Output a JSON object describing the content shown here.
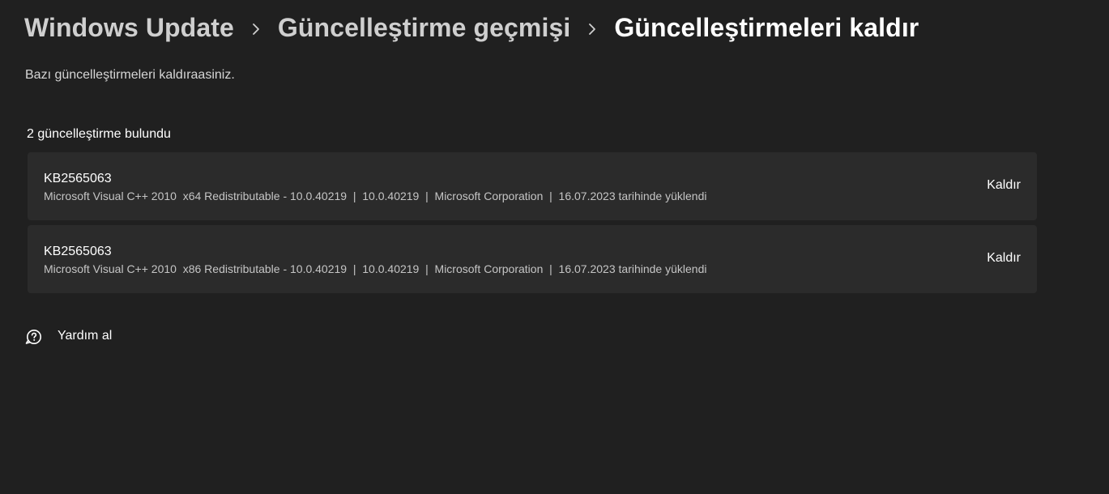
{
  "breadcrumb": {
    "items": [
      "Windows Update",
      "Güncelleştirme geçmişi"
    ],
    "current": "Güncelleştirmeleri kaldır"
  },
  "subtitle": "Bazı güncelleştirmeleri kaldıraasiniz.",
  "updates": {
    "count_label": "2 güncelleştirme bulundu",
    "items": [
      {
        "kb": "KB2565063",
        "details": "Microsoft Visual C++ 2010  x64 Redistributable - 10.0.40219  |  10.0.40219  |  Microsoft Corporation  |  16.07.2023 tarihinde yüklendi",
        "action": "Kaldır"
      },
      {
        "kb": "KB2565063",
        "details": "Microsoft Visual C++ 2010  x86 Redistributable - 10.0.40219  |  10.0.40219  |  Microsoft Corporation  |  16.07.2023 tarihinde yüklendi",
        "action": "Kaldır"
      }
    ]
  },
  "help": {
    "label": "Yardım al",
    "icon": "get-help-icon"
  },
  "colors": {
    "background": "#202020",
    "card": "#2b2b2b",
    "text_primary": "#ffffff",
    "text_secondary": "#c5c5c5"
  }
}
